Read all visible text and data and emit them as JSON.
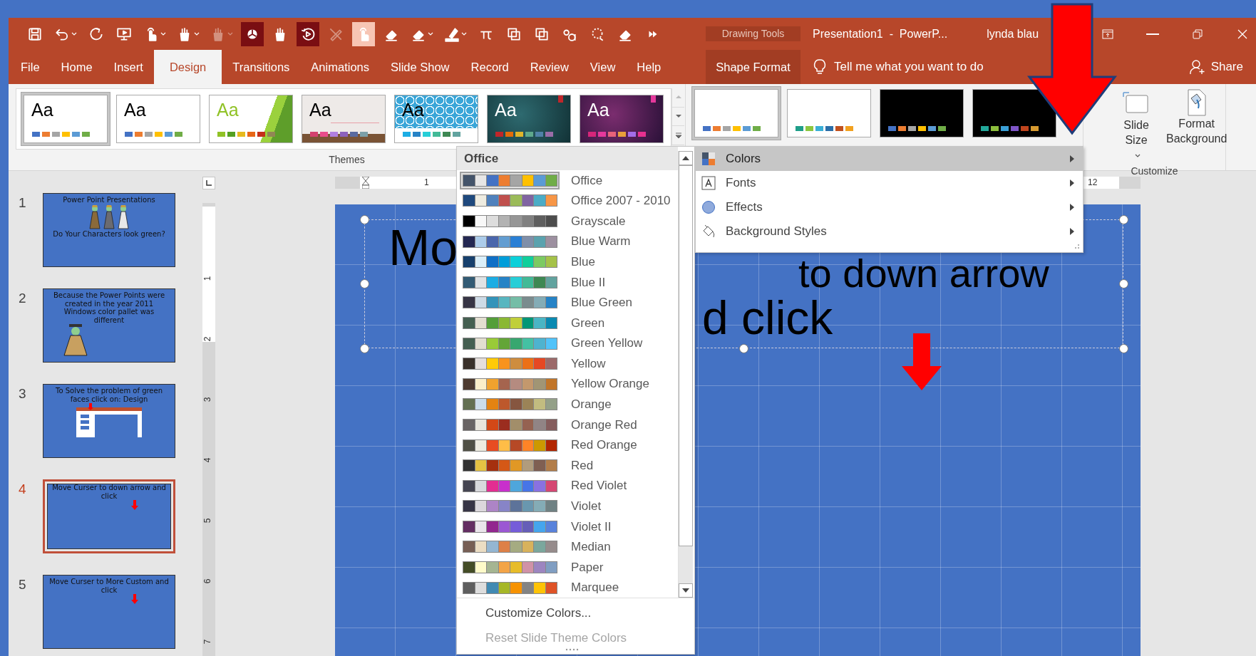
{
  "toolbar": [
    {
      "kind": "save",
      "on": false,
      "selected": false,
      "disabled": false,
      "dropdown": false
    },
    {
      "kind": "undo",
      "on": false,
      "selected": false,
      "disabled": false,
      "dropdown": true
    },
    {
      "kind": "redo",
      "on": false,
      "selected": false,
      "disabled": false,
      "dropdown": false
    },
    {
      "kind": "slideshow",
      "on": false,
      "selected": false,
      "disabled": false,
      "dropdown": false
    },
    {
      "kind": "touch",
      "on": false,
      "selected": false,
      "disabled": false,
      "dropdown": true
    },
    {
      "kind": "pencup",
      "on": false,
      "selected": false,
      "disabled": false,
      "dropdown": true
    },
    {
      "kind": "pencup",
      "on": false,
      "selected": false,
      "disabled": true,
      "dropdown": true
    },
    {
      "kind": "pie",
      "on": true,
      "selected": false,
      "disabled": false,
      "dropdown": false
    },
    {
      "kind": "pencup",
      "on": false,
      "selected": false,
      "disabled": false,
      "dropdown": false
    },
    {
      "kind": "replay",
      "on": true,
      "selected": false,
      "disabled": false,
      "dropdown": false
    },
    {
      "kind": "pen",
      "on": false,
      "selected": false,
      "disabled": true,
      "dropdown": false
    },
    {
      "kind": "touch",
      "on": false,
      "selected": true,
      "disabled": false,
      "dropdown": false
    },
    {
      "kind": "eraser",
      "on": false,
      "selected": false,
      "disabled": false,
      "dropdown": false
    },
    {
      "kind": "eraser",
      "on": false,
      "selected": false,
      "disabled": false,
      "dropdown": true
    },
    {
      "kind": "highlighter",
      "on": false,
      "selected": false,
      "disabled": false,
      "dropdown": true
    },
    {
      "kind": "pi",
      "on": false,
      "selected": false,
      "disabled": false,
      "dropdown": false
    },
    {
      "kind": "copy",
      "on": false,
      "selected": false,
      "disabled": false,
      "dropdown": false
    },
    {
      "kind": "copy",
      "on": false,
      "selected": false,
      "disabled": false,
      "dropdown": false
    },
    {
      "kind": "letters",
      "on": false,
      "selected": false,
      "disabled": false,
      "dropdown": false
    },
    {
      "kind": "lasso",
      "on": false,
      "selected": false,
      "disabled": false,
      "dropdown": false
    },
    {
      "kind": "eraser",
      "on": false,
      "selected": false,
      "disabled": false,
      "dropdown": false
    },
    {
      "kind": "more",
      "on": false,
      "selected": false,
      "disabled": false,
      "dropdown": false
    }
  ],
  "window": {
    "context_label": "Drawing Tools",
    "title": "Presentation1  -  PowerP...",
    "user": "lynda blau"
  },
  "tabs": [
    {
      "label": "File",
      "selected": false
    },
    {
      "label": "Home",
      "selected": false
    },
    {
      "label": "Insert",
      "selected": false
    },
    {
      "label": "Design",
      "selected": true
    },
    {
      "label": "Transitions",
      "selected": false
    },
    {
      "label": "Animations",
      "selected": false
    },
    {
      "label": "Slide Show",
      "selected": false
    },
    {
      "label": "Record",
      "selected": false
    },
    {
      "label": "Review",
      "selected": false
    },
    {
      "label": "View",
      "selected": false
    },
    {
      "label": "Help",
      "selected": false
    }
  ],
  "context_tab": {
    "label": "Shape Format"
  },
  "tell_me": {
    "placeholder": "Tell me what you want to do"
  },
  "share": "Share",
  "themes": {
    "label": "Themes",
    "items": [
      {
        "label": "Aa",
        "kind": "plain",
        "selected": true,
        "swatches": [
          {
            "color": "#4472c4"
          },
          {
            "color": "#ed7d31"
          },
          {
            "color": "#a5a5a5"
          },
          {
            "color": "#ffc000"
          },
          {
            "color": "#5b9bd5"
          },
          {
            "color": "#70ad47"
          }
        ]
      },
      {
        "label": "Aa",
        "kind": "plain",
        "selected": false,
        "swatches": [
          {
            "color": "#4472c4"
          },
          {
            "color": "#ed7d31"
          },
          {
            "color": "#a5a5a5"
          },
          {
            "color": "#ffc000"
          },
          {
            "color": "#5b9bd5"
          },
          {
            "color": "#70ad47"
          }
        ]
      },
      {
        "label": "Aa",
        "kind": "facet",
        "selected": false,
        "swatches": [
          {
            "color": "#90c226"
          },
          {
            "color": "#54a021"
          },
          {
            "color": "#e6b91e"
          },
          {
            "color": "#e76618"
          },
          {
            "color": "#c42f1a"
          },
          {
            "color": "#918655"
          }
        ]
      },
      {
        "label": "Aa",
        "kind": "wood",
        "selected": false,
        "swatches": [
          {
            "color": "#d3416f"
          },
          {
            "color": "#e84c8b"
          },
          {
            "color": "#b07fe0"
          },
          {
            "color": "#8d62bd"
          },
          {
            "color": "#5a6aa0"
          },
          {
            "color": "#7c9fa8"
          }
        ]
      },
      {
        "label": "Aa",
        "kind": "pattern",
        "selected": false,
        "swatches": [
          {
            "color": "#1cade4"
          },
          {
            "color": "#2683c6"
          },
          {
            "color": "#27ced7"
          },
          {
            "color": "#42ba97"
          },
          {
            "color": "#3e8853"
          },
          {
            "color": "#62a39f"
          }
        ]
      },
      {
        "label": "Aa",
        "kind": "teal",
        "selected": false,
        "swatches": [
          {
            "color": "#c0262a"
          },
          {
            "color": "#e46c0a"
          },
          {
            "color": "#e0b52a"
          },
          {
            "color": "#5ea88c"
          },
          {
            "color": "#4f81a8"
          },
          {
            "color": "#9a6da8"
          }
        ]
      },
      {
        "label": "Aa",
        "kind": "purple",
        "selected": false,
        "swatches": [
          {
            "color": "#d7267a"
          },
          {
            "color": "#e5389c"
          },
          {
            "color": "#e8627a"
          },
          {
            "color": "#e8a03a"
          },
          {
            "color": "#a36de8"
          },
          {
            "color": "#e8308f"
          }
        ]
      }
    ]
  },
  "variants": [
    {
      "kind": "light",
      "selected": true,
      "swatches": [
        {
          "color": "#4472c4"
        },
        {
          "color": "#ed7d31"
        },
        {
          "color": "#a5a5a5"
        },
        {
          "color": "#ffc000"
        },
        {
          "color": "#5b9bd5"
        },
        {
          "color": "#70ad47"
        }
      ]
    },
    {
      "kind": "light",
      "selected": false,
      "swatches": [
        {
          "color": "#1f9e89"
        },
        {
          "color": "#8cc63f"
        },
        {
          "color": "#3aafd6"
        },
        {
          "color": "#2b6ea8"
        },
        {
          "color": "#c0501e"
        },
        {
          "color": "#f2a11f"
        }
      ]
    },
    {
      "kind": "dark",
      "selected": false,
      "swatches": [
        {
          "color": "#4472c4"
        },
        {
          "color": "#ed7d31"
        },
        {
          "color": "#a5a5a5"
        },
        {
          "color": "#ffc000"
        },
        {
          "color": "#5b9bd5"
        },
        {
          "color": "#70ad47"
        }
      ]
    },
    {
      "kind": "dark",
      "selected": false,
      "swatches": [
        {
          "color": "#22a89a"
        },
        {
          "color": "#8cbe3c"
        },
        {
          "color": "#3aa0d6"
        },
        {
          "color": "#7e55c7"
        },
        {
          "color": "#c0451e"
        },
        {
          "color": "#d79a30"
        }
      ]
    }
  ],
  "customize": {
    "label": "Customize",
    "buttons": [
      {
        "kind": "slide_size",
        "lines": [
          "Slide",
          "Size"
        ],
        "dropdown": true
      },
      {
        "kind": "format_background",
        "lines": [
          "Format",
          "Background"
        ],
        "dropdown": false
      }
    ]
  },
  "slides": [
    {
      "number": "1",
      "selected": false,
      "kind": "figures",
      "texts": [
        "Power Point Presentations",
        "Do Your Characters look green?"
      ]
    },
    {
      "number": "2",
      "selected": false,
      "kind": "figure",
      "texts": [
        "Because the Power Points were created in the year 2011 Windows color pallet was different"
      ]
    },
    {
      "number": "3",
      "selected": false,
      "kind": "screenshot",
      "texts": [
        "To Solve the problem of green faces click on: Design"
      ]
    },
    {
      "number": "4",
      "selected": true,
      "kind": "arrow",
      "texts": [
        "Move Curser to down arrow and click"
      ]
    },
    {
      "number": "5",
      "selected": false,
      "kind": "arrow",
      "texts": [
        "Move Curser to More Custom and click"
      ]
    }
  ],
  "horizontal_ruler": [
    "1",
    "12"
  ],
  "vertical_ruler": [
    "1",
    "2",
    "3",
    "4",
    "5",
    "6",
    "7"
  ],
  "slide_text": [
    "Mo",
    "to down arrow",
    "d click"
  ],
  "colors_dropdown": {
    "header": "Office",
    "schemes": [
      {
        "name": "Office",
        "selected": true,
        "colors": [
          {
            "color": "#44546a"
          },
          {
            "color": "#e7e6e6"
          },
          {
            "color": "#4472c4"
          },
          {
            "color": "#ed7d31"
          },
          {
            "color": "#a5a5a5"
          },
          {
            "color": "#ffc000"
          },
          {
            "color": "#5b9bd5"
          },
          {
            "color": "#70ad47"
          }
        ]
      },
      {
        "name": "Office 2007 - 2010",
        "selected": false,
        "colors": [
          {
            "color": "#1f497d"
          },
          {
            "color": "#eeece1"
          },
          {
            "color": "#4f81bd"
          },
          {
            "color": "#c0504d"
          },
          {
            "color": "#9bbb59"
          },
          {
            "color": "#8064a2"
          },
          {
            "color": "#4bacc6"
          },
          {
            "color": "#f79646"
          }
        ]
      },
      {
        "name": "Grayscale",
        "selected": false,
        "colors": [
          {
            "color": "#000000"
          },
          {
            "color": "#f8f8f8"
          },
          {
            "color": "#dddddd"
          },
          {
            "color": "#b2b2b2"
          },
          {
            "color": "#969696"
          },
          {
            "color": "#808080"
          },
          {
            "color": "#5f5f5f"
          },
          {
            "color": "#4d4d4d"
          }
        ]
      },
      {
        "name": "Blue Warm",
        "selected": false,
        "colors": [
          {
            "color": "#242852"
          },
          {
            "color": "#acccea"
          },
          {
            "color": "#4a66ac"
          },
          {
            "color": "#629dd1"
          },
          {
            "color": "#297fd5"
          },
          {
            "color": "#7f8fa9"
          },
          {
            "color": "#5aa2ae"
          },
          {
            "color": "#9d90a0"
          }
        ]
      },
      {
        "name": "Blue",
        "selected": false,
        "colors": [
          {
            "color": "#17406d"
          },
          {
            "color": "#dbeff9"
          },
          {
            "color": "#0f6fc6"
          },
          {
            "color": "#009dd9"
          },
          {
            "color": "#0bd0d9"
          },
          {
            "color": "#10cf9b"
          },
          {
            "color": "#7cca62"
          },
          {
            "color": "#a5c249"
          }
        ]
      },
      {
        "name": "Blue II",
        "selected": false,
        "colors": [
          {
            "color": "#335b74"
          },
          {
            "color": "#dfe3e5"
          },
          {
            "color": "#1cade4"
          },
          {
            "color": "#2683c6"
          },
          {
            "color": "#27ced7"
          },
          {
            "color": "#42ba97"
          },
          {
            "color": "#3e8853"
          },
          {
            "color": "#62a39f"
          }
        ]
      },
      {
        "name": "Blue Green",
        "selected": false,
        "colors": [
          {
            "color": "#373545"
          },
          {
            "color": "#cedbe6"
          },
          {
            "color": "#3494ba"
          },
          {
            "color": "#58b6c0"
          },
          {
            "color": "#75bda7"
          },
          {
            "color": "#7a8c8e"
          },
          {
            "color": "#84acb6"
          },
          {
            "color": "#2683c6"
          }
        ]
      },
      {
        "name": "Green",
        "selected": false,
        "colors": [
          {
            "color": "#455f51"
          },
          {
            "color": "#e3ded1"
          },
          {
            "color": "#549e39"
          },
          {
            "color": "#8ab833"
          },
          {
            "color": "#c0cf3a"
          },
          {
            "color": "#029676"
          },
          {
            "color": "#4ab5c4"
          },
          {
            "color": "#0989b1"
          }
        ]
      },
      {
        "name": "Green Yellow",
        "selected": false,
        "colors": [
          {
            "color": "#455f51"
          },
          {
            "color": "#e3ded1"
          },
          {
            "color": "#99cb38"
          },
          {
            "color": "#63a537"
          },
          {
            "color": "#37a76f"
          },
          {
            "color": "#44c1a3"
          },
          {
            "color": "#4eb3cf"
          },
          {
            "color": "#51c3f9"
          }
        ]
      },
      {
        "name": "Yellow",
        "selected": false,
        "colors": [
          {
            "color": "#39302a"
          },
          {
            "color": "#e5dedb"
          },
          {
            "color": "#ffca08"
          },
          {
            "color": "#f8931d"
          },
          {
            "color": "#ce8d3e"
          },
          {
            "color": "#ec7016"
          },
          {
            "color": "#e64823"
          },
          {
            "color": "#9c6a6a"
          }
        ]
      },
      {
        "name": "Yellow Orange",
        "selected": false,
        "colors": [
          {
            "color": "#4e3b30"
          },
          {
            "color": "#fbeec9"
          },
          {
            "color": "#f0a22e"
          },
          {
            "color": "#a5644e"
          },
          {
            "color": "#b58b80"
          },
          {
            "color": "#c3986d"
          },
          {
            "color": "#a19574"
          },
          {
            "color": "#c17529"
          }
        ]
      },
      {
        "name": "Orange",
        "selected": false,
        "colors": [
          {
            "color": "#637052"
          },
          {
            "color": "#ccddea"
          },
          {
            "color": "#e48312"
          },
          {
            "color": "#bd582c"
          },
          {
            "color": "#865640"
          },
          {
            "color": "#9b8357"
          },
          {
            "color": "#c2bc80"
          },
          {
            "color": "#94a088"
          }
        ]
      },
      {
        "name": "Orange Red",
        "selected": false,
        "colors": [
          {
            "color": "#696464"
          },
          {
            "color": "#e9e5dc"
          },
          {
            "color": "#d34817"
          },
          {
            "color": "#9b2d1f"
          },
          {
            "color": "#a28e6a"
          },
          {
            "color": "#956251"
          },
          {
            "color": "#918485"
          },
          {
            "color": "#855d5d"
          }
        ]
      },
      {
        "name": "Red Orange",
        "selected": false,
        "colors": [
          {
            "color": "#505046"
          },
          {
            "color": "#eeece1"
          },
          {
            "color": "#e84c22"
          },
          {
            "color": "#ffbd47"
          },
          {
            "color": "#b64926"
          },
          {
            "color": "#ff8427"
          },
          {
            "color": "#cc9900"
          },
          {
            "color": "#b22600"
          }
        ]
      },
      {
        "name": "Red",
        "selected": false,
        "colors": [
          {
            "color": "#323232"
          },
          {
            "color": "#e5c243"
          },
          {
            "color": "#a5300f"
          },
          {
            "color": "#d55816"
          },
          {
            "color": "#e19825"
          },
          {
            "color": "#b19c7d"
          },
          {
            "color": "#7f5f52"
          },
          {
            "color": "#b27d49"
          }
        ]
      },
      {
        "name": "Red Violet",
        "selected": false,
        "colors": [
          {
            "color": "#454551"
          },
          {
            "color": "#d8d9dc"
          },
          {
            "color": "#e32d91"
          },
          {
            "color": "#c830cc"
          },
          {
            "color": "#4ea6dc"
          },
          {
            "color": "#4775e7"
          },
          {
            "color": "#8971e1"
          },
          {
            "color": "#d54773"
          }
        ]
      },
      {
        "name": "Violet",
        "selected": false,
        "colors": [
          {
            "color": "#373545"
          },
          {
            "color": "#dcd8dc"
          },
          {
            "color": "#ad84c6"
          },
          {
            "color": "#8784c7"
          },
          {
            "color": "#5d739a"
          },
          {
            "color": "#6997af"
          },
          {
            "color": "#84acb6"
          },
          {
            "color": "#6f8183"
          }
        ]
      },
      {
        "name": "Violet II",
        "selected": false,
        "colors": [
          {
            "color": "#632e62"
          },
          {
            "color": "#eae5eb"
          },
          {
            "color": "#92278f"
          },
          {
            "color": "#9b57d3"
          },
          {
            "color": "#755dd9"
          },
          {
            "color": "#665eb8"
          },
          {
            "color": "#45a5ed"
          },
          {
            "color": "#5982db"
          }
        ]
      },
      {
        "name": "Median",
        "selected": false,
        "colors": [
          {
            "color": "#775f55"
          },
          {
            "color": "#ebddc3"
          },
          {
            "color": "#94b6d2"
          },
          {
            "color": "#dd8047"
          },
          {
            "color": "#a5ab81"
          },
          {
            "color": "#d8b25c"
          },
          {
            "color": "#7ba79d"
          },
          {
            "color": "#968c8c"
          }
        ]
      },
      {
        "name": "Paper",
        "selected": false,
        "colors": [
          {
            "color": "#444d26"
          },
          {
            "color": "#fefac9"
          },
          {
            "color": "#a5b592"
          },
          {
            "color": "#f3a447"
          },
          {
            "color": "#e7bc29"
          },
          {
            "color": "#d092a7"
          },
          {
            "color": "#9c85c0"
          },
          {
            "color": "#809ec2"
          }
        ]
      },
      {
        "name": "Marquee",
        "selected": false,
        "colors": [
          {
            "color": "#5e5e5e"
          },
          {
            "color": "#dddddd"
          },
          {
            "color": "#418ab3"
          },
          {
            "color": "#a6b727"
          },
          {
            "color": "#f69200"
          },
          {
            "color": "#838383"
          },
          {
            "color": "#fec306"
          },
          {
            "color": "#df5327"
          }
        ]
      }
    ],
    "footer": [
      {
        "label": "Customize Colors...",
        "disabled": false
      },
      {
        "label": "Reset Slide Theme Colors",
        "disabled": true
      }
    ]
  },
  "design_menu": [
    {
      "kind": "colors",
      "label": "Colors",
      "selected": true
    },
    {
      "kind": "fonts",
      "label": "Fonts",
      "selected": false
    },
    {
      "kind": "effects",
      "label": "Effects",
      "selected": false
    },
    {
      "kind": "background",
      "label": "Background Styles",
      "selected": false
    }
  ]
}
